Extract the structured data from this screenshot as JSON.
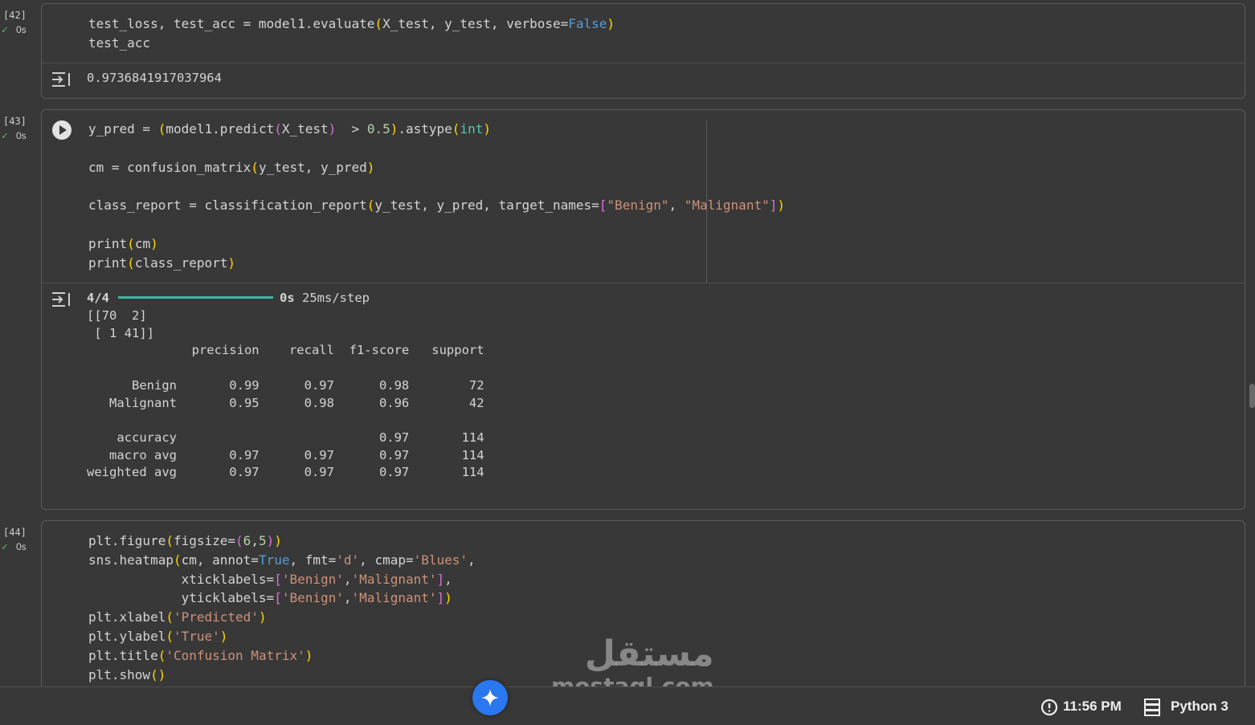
{
  "cells": [
    {
      "number": "[42]",
      "exec_time": "0s",
      "output_text": "0.9736841917037964"
    },
    {
      "number": "[43]",
      "exec_time": "0s",
      "progress_label": "4/4",
      "progress_fraction": 1.0,
      "progress_time": "0s",
      "progress_rate": "25ms/step",
      "output_text": "[[70  2]\n [ 1 41]]\n              precision    recall  f1-score   support\n\n      Benign       0.99      0.97      0.98        72\n   Malignant       0.95      0.98      0.96        42\n\n    accuracy                           0.97       114\n   macro avg       0.97      0.97      0.97       114\nweighted avg       0.97      0.97      0.97       114"
    },
    {
      "number": "[44]",
      "exec_time": "0s"
    }
  ],
  "status": {
    "time": "11:56 PM",
    "runtime": "Python 3"
  },
  "watermark": {
    "arabic": "مستقل",
    "latin": "mostaql.com"
  },
  "colors": {
    "keyword": "#569cd6",
    "string": "#ce9178",
    "number": "#b5cea8",
    "bracket1": "#ffd700",
    "bracket2": "#da70d6",
    "success": "#5fb86a",
    "progress": "#3fb6a3",
    "gemini": "#2a78f0"
  },
  "icons": {
    "check": "check-icon",
    "output": "output-collapse-icon",
    "run": "run-icon",
    "clock": "alert-clock-icon",
    "runtime": "server-icon",
    "gemini": "sparkle-icon"
  }
}
